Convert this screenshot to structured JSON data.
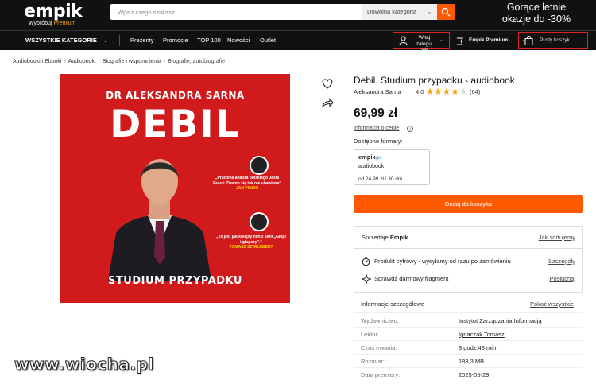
{
  "header": {
    "logo": "empik",
    "logo_sub_prefix": "Wypróbuj",
    "logo_sub_highlight": "Premium",
    "search_placeholder": "Wpisz czego szukasz",
    "search_category": "Dowolna kategoria",
    "promo_line1": "Gorące letnie",
    "promo_line2": "okazje do -30%"
  },
  "nav": {
    "all_categories": "WSZYSTKIE KATEGORIE",
    "links": [
      "Prezenty",
      "Promocje",
      "TOP 100",
      "Nowości",
      "Outlet"
    ],
    "login_line1": "Witaj",
    "login_line2": "zaloguj się",
    "premium": "Empik Premium",
    "cart": "Pusty koszyk"
  },
  "breadcrumb": [
    "Audiobooki i Ebooki",
    "Audiobooki",
    "Biografie i wspomnienia",
    "Biografie, autobiografie"
  ],
  "cover": {
    "author": "DR ALEKSANDRA SARNA",
    "title": "DEBIL",
    "subtitle": "STUDIUM PRZYPADKU",
    "quote1": "„Przednia analiza polskiego Jasia Fasoli. Dawno się tak nie ubawiłem”",
    "quote1_by": "JAN PINSKI",
    "quote2": "„To jest jak kolejny film z serii „Głupi i głupszy”.”",
    "quote2_by": "TOMASZ SZWEJGIERT"
  },
  "product": {
    "title": "Debil. Studium przypadku - audiobook",
    "author": "Aleksandra Sarna",
    "rating": "4,0",
    "rating_value": 4.0,
    "rating_max": 5,
    "rating_count": "(64)",
    "price": "69,99 zł",
    "price_info": "Informacja o cenie",
    "formats_label": "Dostępne formaty:",
    "format_brand": "empik",
    "format_brand_suffix": "go",
    "format_type": "audiobook",
    "format_price": "od 24,99 zł / 30 dni",
    "add_to_cart": "Dodaj do koszyka"
  },
  "seller_box": {
    "seller_prefix": "Sprzedaje",
    "seller_name": "Empik",
    "seller_link": "Jak sortujemy",
    "row1_text": "Produkt cyfrowy - wysyłamy od razu po zamówieniu",
    "row1_link": "Szczegóły",
    "row2_text": "Sprawdź darmowy fragment",
    "row2_link": "Posłuchaj"
  },
  "details": {
    "heading": "Informacje szczegółowe",
    "show_all": "Pokaż wszystkie",
    "rows": [
      {
        "label": "Wydawnictwo:",
        "value": "Instytut Zarządzania Informacją"
      },
      {
        "label": "Lektor:",
        "value": "Ignaczak Tomasz"
      },
      {
        "label": "Czas trwania:",
        "value": "3 godz.43 min."
      },
      {
        "label": "Rozmiar:",
        "value": "183,3 MB"
      },
      {
        "label": "Data premiery:",
        "value": "2025-05-29"
      }
    ]
  },
  "watermark": "www.wiocha.pl"
}
